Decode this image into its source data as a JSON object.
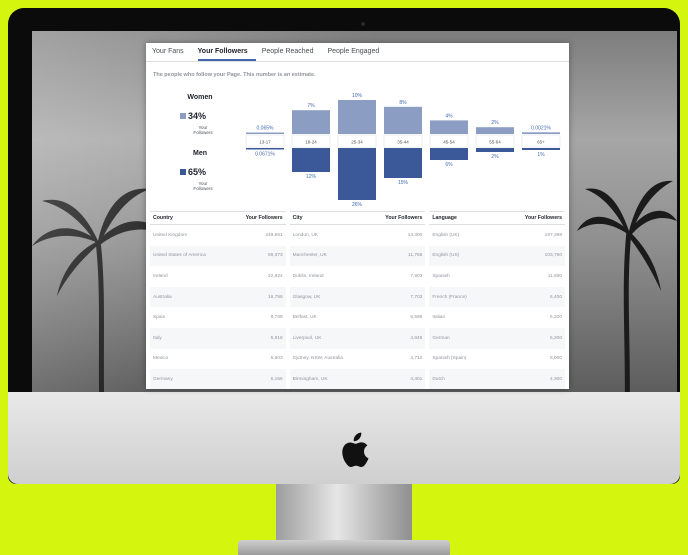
{
  "tabs": [
    "Your Fans",
    "Your Followers",
    "People Reached",
    "People Engaged"
  ],
  "active_tab_index": 1,
  "subtitle": "The people who follow your Page. This number is an estimate.",
  "women": {
    "label": "Women",
    "percent": "34%",
    "sub1": "Your",
    "sub2": "Followers",
    "color": "#8b9dc3"
  },
  "men": {
    "label": "Men",
    "percent": "65%",
    "sub1": "Your",
    "sub2": "Followers",
    "color": "#3b5998"
  },
  "chart_data": {
    "type": "bar",
    "categories": [
      "13-17",
      "18-24",
      "25-34",
      "35-44",
      "45-54",
      "55-64",
      "65+"
    ],
    "series": [
      {
        "name": "Women",
        "values": [
          0.065,
          7,
          10,
          8,
          4,
          2,
          0.5
        ],
        "labels": [
          "0.065%",
          "7%",
          "10%",
          "8%",
          "4%",
          "2%",
          "0.0021%"
        ]
      },
      {
        "name": "Men",
        "values": [
          0.1,
          12,
          26,
          15,
          6,
          2,
          1
        ],
        "labels": [
          "0.0671%",
          "12%",
          "26%",
          "15%",
          "6%",
          "2%",
          "1%"
        ]
      }
    ]
  },
  "country_table": {
    "headers": [
      "Country",
      "Your Followers"
    ],
    "rows": [
      [
        "United Kingdom",
        "249,551"
      ],
      [
        "United States of America",
        "59,373"
      ],
      [
        "Ireland",
        "22,624"
      ],
      [
        "Australia",
        "16,756"
      ],
      [
        "Spain",
        "8,768"
      ],
      [
        "Italy",
        "5,918"
      ],
      [
        "Mexico",
        "5,603"
      ],
      [
        "Germany",
        "5,156"
      ]
    ]
  },
  "city_table": {
    "headers": [
      "City",
      "Your Followers"
    ],
    "rows": [
      [
        "London, UK",
        "13,300"
      ],
      [
        "Manchester, UK",
        "11,766"
      ],
      [
        "Dublin, Ireland",
        "7,903"
      ],
      [
        "Glasgow, UK",
        "7,703"
      ],
      [
        "Belfast, UK",
        "6,598"
      ],
      [
        "Liverpool, UK",
        "4,846"
      ],
      [
        "Sydney, NSW, Australia",
        "4,710"
      ],
      [
        "Birmingham, UK",
        "4,401"
      ]
    ]
  },
  "language_table": {
    "headers": [
      "Language",
      "Your Followers"
    ],
    "rows": [
      [
        "English (UK)",
        "197,398"
      ],
      [
        "English (US)",
        "103,750"
      ],
      [
        "Spanish",
        "11,800"
      ],
      [
        "French (France)",
        "6,400"
      ],
      [
        "Italian",
        "6,200"
      ],
      [
        "German",
        "5,200"
      ],
      [
        "Spanish (Spain)",
        "5,000"
      ],
      [
        "Dutch",
        "4,300"
      ]
    ]
  }
}
